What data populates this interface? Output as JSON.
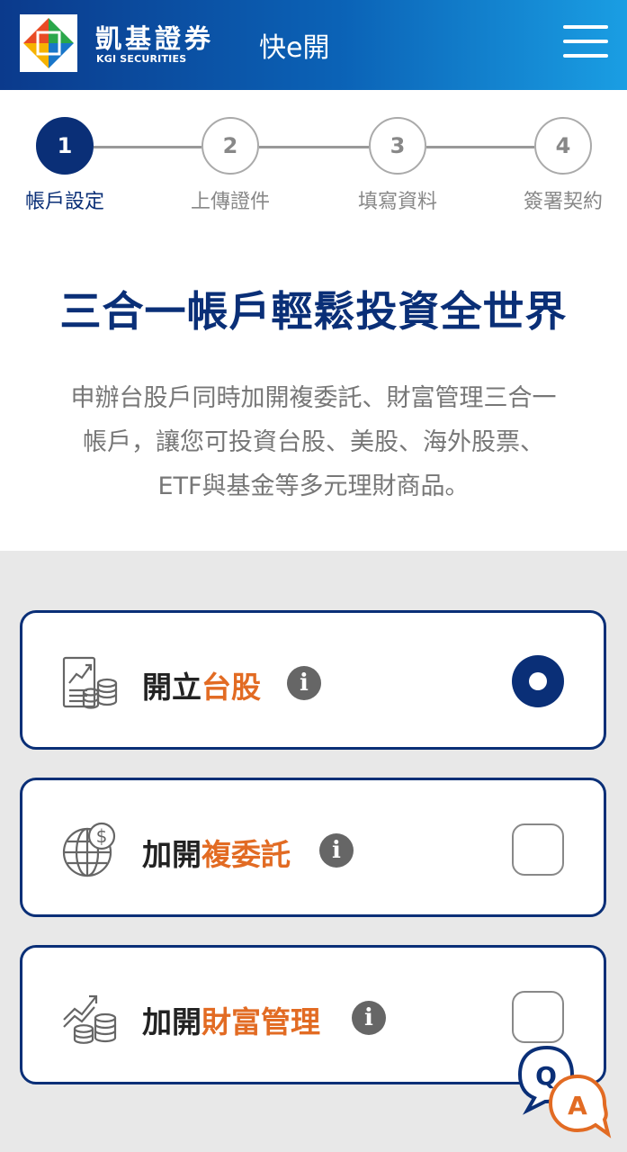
{
  "header": {
    "brand_cn": "凱基證券",
    "brand_en": "KGI SECURITIES",
    "app_title": "快e開",
    "menu_icon": "hamburger-menu-icon"
  },
  "stepper": {
    "current_step": 1,
    "steps": [
      {
        "number": "1",
        "label": "帳戶設定"
      },
      {
        "number": "2",
        "label": "上傳證件"
      },
      {
        "number": "3",
        "label": "填寫資料"
      },
      {
        "number": "4",
        "label": "簽署契約"
      }
    ]
  },
  "headline": "三合一帳戶輕鬆投資全世界",
  "description": [
    "申辦台股戶同時加開複委託、財富管理三合一",
    "帳戶，讓您可投資台股、美股、海外股票、",
    "ETF與基金等多元理財商品。"
  ],
  "options": [
    {
      "prefix": "開立",
      "highlight": "台股",
      "icon": "stock-chart-coins-icon",
      "control": "radio",
      "selected": true
    },
    {
      "prefix": "加開",
      "highlight": "複委託",
      "icon": "globe-dollar-icon",
      "control": "checkbox",
      "selected": false
    },
    {
      "prefix": "加開",
      "highlight": "財富管理",
      "icon": "growth-coins-icon",
      "control": "checkbox",
      "selected": false
    }
  ],
  "info_glyph": "i",
  "qa_button": {
    "q": "Q",
    "a": "A"
  },
  "colors": {
    "primary": "#0a2f77",
    "accent": "#e26b23",
    "header_gradient_start": "#0b3a8c",
    "header_gradient_end": "#1a9ee3",
    "section_bg": "#e8e8e8"
  }
}
